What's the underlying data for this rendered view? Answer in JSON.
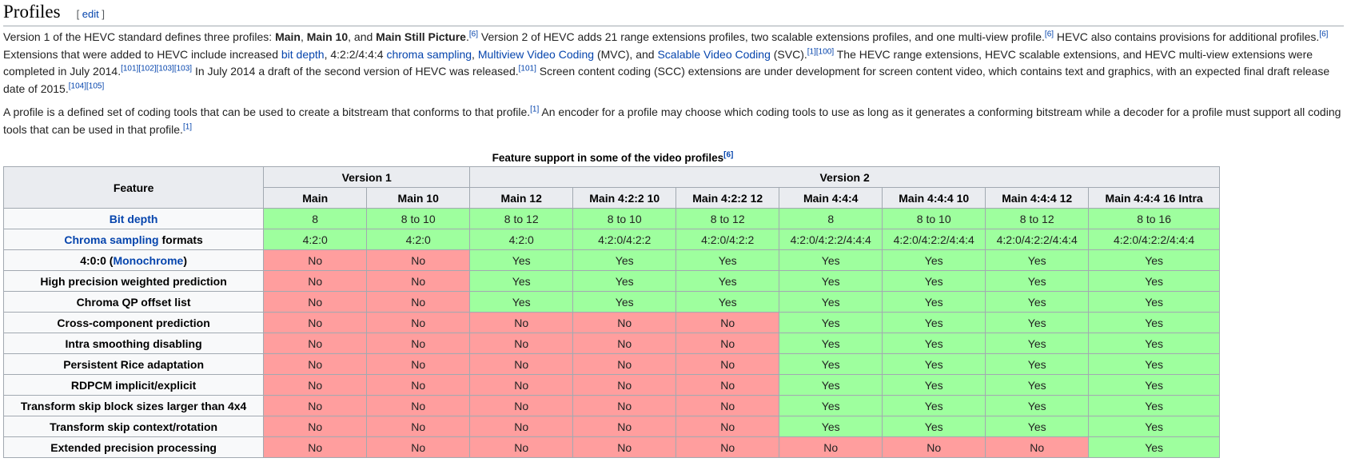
{
  "section": {
    "title": "Profiles",
    "edit_open": "[ ",
    "edit_label": "edit",
    "edit_close": " ]"
  },
  "para1": {
    "t1": "Version 1 of the HEVC standard defines three profiles: ",
    "b1": "Main",
    "t2": ", ",
    "b2": "Main 10",
    "t3": ", and ",
    "b3": "Main Still Picture",
    "t4": ".",
    "s1": "[6]",
    "t5": " Version 2 of HEVC adds 21 range extensions profiles, two scalable extensions profiles, and one multi-view profile.",
    "s2": "[6]",
    "t6": " HEVC also contains provisions for additional profiles.",
    "s3": "[6]",
    "t7": " Extensions that were added to HEVC include increased ",
    "l1": "bit depth",
    "t8": ", 4:2:2/4:4:4 ",
    "l2": "chroma sampling",
    "t9": ", ",
    "l3": "Multiview Video Coding",
    "t10": " (MVC), and ",
    "l4": "Scalable Video Coding",
    "t11": " (SVC).",
    "s4": "[1][100]",
    "t12": " The HEVC range extensions, HEVC scalable extensions, and HEVC multi-view extensions were completed in July 2014.",
    "s5": "[101][102][103][103]",
    "t13": " In July 2014 a draft of the second version of HEVC was released.",
    "s6": "[101]",
    "t14": " Screen content coding (SCC) extensions are under development for screen content video, which contains text and graphics, with an expected final draft release date of 2015.",
    "s7": "[104][105]"
  },
  "para2": {
    "t1": "A profile is a defined set of coding tools that can be used to create a bitstream that conforms to that profile.",
    "s1": "[1]",
    "t2": " An encoder for a profile may choose which coding tools to use as long as it generates a conforming bitstream while a decoder for a profile must support all coding tools that can be used in that profile.",
    "s2": "[1]"
  },
  "table": {
    "caption": "Feature support in some of the video profiles",
    "caption_sup": "[6]",
    "feature_header": "Feature",
    "groups": [
      {
        "label": "Version 1",
        "span": 2
      },
      {
        "label": "Version 2",
        "span": 7
      }
    ],
    "profiles": [
      "Main",
      "Main 10",
      "Main 12",
      "Main 4:2:2 10",
      "Main 4:2:2 12",
      "Main 4:4:4",
      "Main 4:4:4 10",
      "Main 4:4:4 12",
      "Main 4:4:4 16 Intra"
    ],
    "rows": [
      {
        "label_link": "Bit depth",
        "label": "",
        "label_post": "",
        "color": "green",
        "cells": [
          "8",
          "8 to 10",
          "8 to 12",
          "8 to 10",
          "8 to 12",
          "8",
          "8 to 10",
          "8 to 12",
          "8 to 16"
        ]
      },
      {
        "label_link": "Chroma sampling",
        "label": " formats",
        "label_post": "",
        "color": "green",
        "cells": [
          "4:2:0",
          "4:2:0",
          "4:2:0",
          "4:2:0/4:2:2",
          "4:2:0/4:2:2",
          "4:2:0/4:2:2/4:4:4",
          "4:2:0/4:2:2/4:4:4",
          "4:2:0/4:2:2/4:4:4",
          "4:2:0/4:2:2/4:4:4"
        ]
      },
      {
        "label_pre": "4:0:0 (",
        "label_link": "Monochrome",
        "label": ")",
        "cells": [
          "No",
          "No",
          "Yes",
          "Yes",
          "Yes",
          "Yes",
          "Yes",
          "Yes",
          "Yes"
        ]
      },
      {
        "label": "High precision weighted prediction",
        "cells": [
          "No",
          "No",
          "Yes",
          "Yes",
          "Yes",
          "Yes",
          "Yes",
          "Yes",
          "Yes"
        ]
      },
      {
        "label": "Chroma QP offset list",
        "cells": [
          "No",
          "No",
          "Yes",
          "Yes",
          "Yes",
          "Yes",
          "Yes",
          "Yes",
          "Yes"
        ]
      },
      {
        "label": "Cross-component prediction",
        "cells": [
          "No",
          "No",
          "No",
          "No",
          "No",
          "Yes",
          "Yes",
          "Yes",
          "Yes"
        ]
      },
      {
        "label": "Intra smoothing disabling",
        "cells": [
          "No",
          "No",
          "No",
          "No",
          "No",
          "Yes",
          "Yes",
          "Yes",
          "Yes"
        ]
      },
      {
        "label": "Persistent Rice adaptation",
        "cells": [
          "No",
          "No",
          "No",
          "No",
          "No",
          "Yes",
          "Yes",
          "Yes",
          "Yes"
        ]
      },
      {
        "label": "RDPCM implicit/explicit",
        "cells": [
          "No",
          "No",
          "No",
          "No",
          "No",
          "Yes",
          "Yes",
          "Yes",
          "Yes"
        ]
      },
      {
        "label": "Transform skip block sizes larger than 4x4",
        "cells": [
          "No",
          "No",
          "No",
          "No",
          "No",
          "Yes",
          "Yes",
          "Yes",
          "Yes"
        ]
      },
      {
        "label": "Transform skip context/rotation",
        "cells": [
          "No",
          "No",
          "No",
          "No",
          "No",
          "Yes",
          "Yes",
          "Yes",
          "Yes"
        ]
      },
      {
        "label": "Extended precision processing",
        "cells": [
          "No",
          "No",
          "No",
          "No",
          "No",
          "No",
          "No",
          "No",
          "Yes"
        ]
      }
    ]
  },
  "colors": {
    "yes": "#9eff9e",
    "no": "#ff9e9e",
    "link": "#0645ad",
    "header_bg": "#eaecf0"
  }
}
